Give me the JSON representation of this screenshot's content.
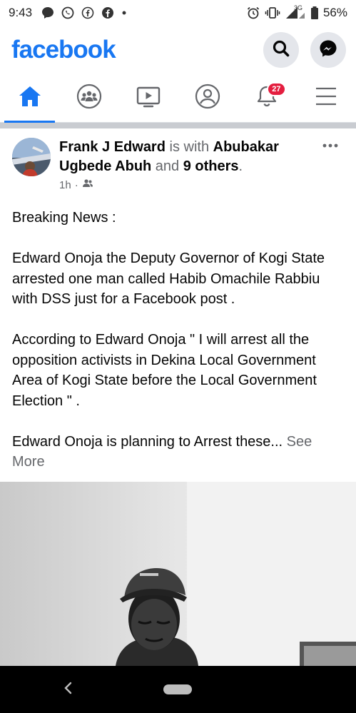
{
  "status_bar": {
    "time": "9:43",
    "network": "3G",
    "battery": "56%"
  },
  "header": {
    "logo": "facebook",
    "brand_color": "#1877f2",
    "actions": [
      "search-icon",
      "messenger-icon"
    ]
  },
  "tabs": [
    {
      "name": "home",
      "icon": "home-icon",
      "active": true
    },
    {
      "name": "groups",
      "icon": "groups-icon",
      "active": false
    },
    {
      "name": "watch",
      "icon": "video-icon",
      "active": false
    },
    {
      "name": "profile",
      "icon": "profile-icon",
      "active": false
    },
    {
      "name": "notifications",
      "icon": "bell-icon",
      "active": false,
      "badge": "27"
    },
    {
      "name": "menu",
      "icon": "menu-icon",
      "active": false
    }
  ],
  "post": {
    "author": "Frank J Edward",
    "with_text": " is with ",
    "tagged": "Abubakar Ugbede Abuh",
    "and_text": " and ",
    "others": "9 others",
    "period": ".",
    "time": "1h",
    "separator": "·",
    "audience_icon": "friends-icon",
    "paragraphs": [
      "Breaking News :",
      "Edward Onoja the Deputy Governor of Kogi State  arrested one man called Habib Omachile Rabbiu with DSS just for a Facebook post .",
      "According to Edward Onoja \" I will arrest all the opposition activists in Dekina Local Government Area of Kogi State before the Local Government Election \" .",
      "Edward Onoja is planning to Arrest these..."
    ],
    "see_more": "See More"
  }
}
